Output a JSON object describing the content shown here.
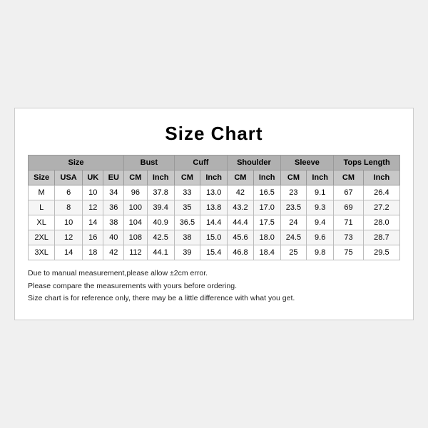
{
  "title": "Size Chart",
  "table": {
    "header_row1": [
      {
        "label": "Size",
        "colspan": 4
      },
      {
        "label": "Bust",
        "colspan": 2
      },
      {
        "label": "Cuff",
        "colspan": 2
      },
      {
        "label": "Shoulder",
        "colspan": 2
      },
      {
        "label": "Sleeve",
        "colspan": 2
      },
      {
        "label": "Tops Length",
        "colspan": 2
      }
    ],
    "header_row2": [
      {
        "label": "Size"
      },
      {
        "label": "USA"
      },
      {
        "label": "UK"
      },
      {
        "label": "EU"
      },
      {
        "label": "CM"
      },
      {
        "label": "Inch"
      },
      {
        "label": "CM"
      },
      {
        "label": "Inch"
      },
      {
        "label": "CM"
      },
      {
        "label": "Inch"
      },
      {
        "label": "CM"
      },
      {
        "label": "Inch"
      },
      {
        "label": "CM"
      },
      {
        "label": "Inch"
      }
    ],
    "rows": [
      [
        "M",
        "6",
        "10",
        "34",
        "96",
        "37.8",
        "33",
        "13.0",
        "42",
        "16.5",
        "23",
        "9.1",
        "67",
        "26.4"
      ],
      [
        "L",
        "8",
        "12",
        "36",
        "100",
        "39.4",
        "35",
        "13.8",
        "43.2",
        "17.0",
        "23.5",
        "9.3",
        "69",
        "27.2"
      ],
      [
        "XL",
        "10",
        "14",
        "38",
        "104",
        "40.9",
        "36.5",
        "14.4",
        "44.4",
        "17.5",
        "24",
        "9.4",
        "71",
        "28.0"
      ],
      [
        "2XL",
        "12",
        "16",
        "40",
        "108",
        "42.5",
        "38",
        "15.0",
        "45.6",
        "18.0",
        "24.5",
        "9.6",
        "73",
        "28.7"
      ],
      [
        "3XL",
        "14",
        "18",
        "42",
        "112",
        "44.1",
        "39",
        "15.4",
        "46.8",
        "18.4",
        "25",
        "9.8",
        "75",
        "29.5"
      ]
    ]
  },
  "notes": [
    "Due to manual measurement,please allow ±2cm error.",
    "Please compare the measurements with yours before ordering.",
    "Size chart is for reference only, there may be a little difference with what you get."
  ]
}
